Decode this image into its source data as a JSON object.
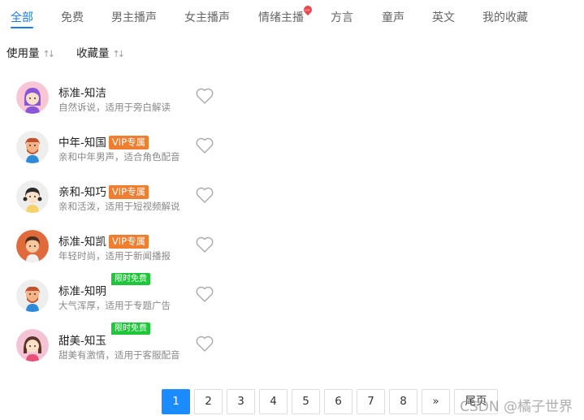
{
  "tabs": [
    {
      "label": "全部",
      "active": true
    },
    {
      "label": "免费"
    },
    {
      "label": "男主播声"
    },
    {
      "label": "女主播声"
    },
    {
      "label": "情绪主播",
      "badge": "HOT"
    },
    {
      "label": "方言"
    },
    {
      "label": "童声"
    },
    {
      "label": "英文"
    },
    {
      "label": "我的收藏"
    }
  ],
  "sort": [
    {
      "label": "使用量",
      "icon": "sort-icon"
    },
    {
      "label": "收藏量",
      "icon": "sort-icon"
    }
  ],
  "voices": [
    {
      "name": "标准-知洁",
      "desc": "自然诉说，适用于旁白解读",
      "tag": ""
    },
    {
      "name": "中年-知国",
      "desc": "亲和中年男声，适合角色配音",
      "tag": "VIP专属"
    },
    {
      "name": "亲和-知巧",
      "desc": "亲和活泼，适用于短视频解说",
      "tag": "VIP专属"
    },
    {
      "name": "标准-知凯",
      "desc": "年轻时尚，适用于新闻播报",
      "tag": "VIP专属"
    },
    {
      "name": "标准-知明",
      "desc": "大气浑厚，适用于专题广告",
      "tag": "限时免费"
    },
    {
      "name": "甜美-知玉",
      "desc": "甜美有激情，适用于客服配音",
      "tag": "限时免费"
    }
  ],
  "pagination": {
    "pages": [
      "1",
      "2",
      "3",
      "4",
      "5",
      "6",
      "7",
      "8"
    ],
    "current": "1",
    "next": "»",
    "last": "尾页"
  },
  "watermark": "CSDN @橘子世界",
  "colors": {
    "accent": "#1a7bf2",
    "vip": "#f07e31",
    "free": "#1ec73a",
    "hot": "#f0444b"
  }
}
